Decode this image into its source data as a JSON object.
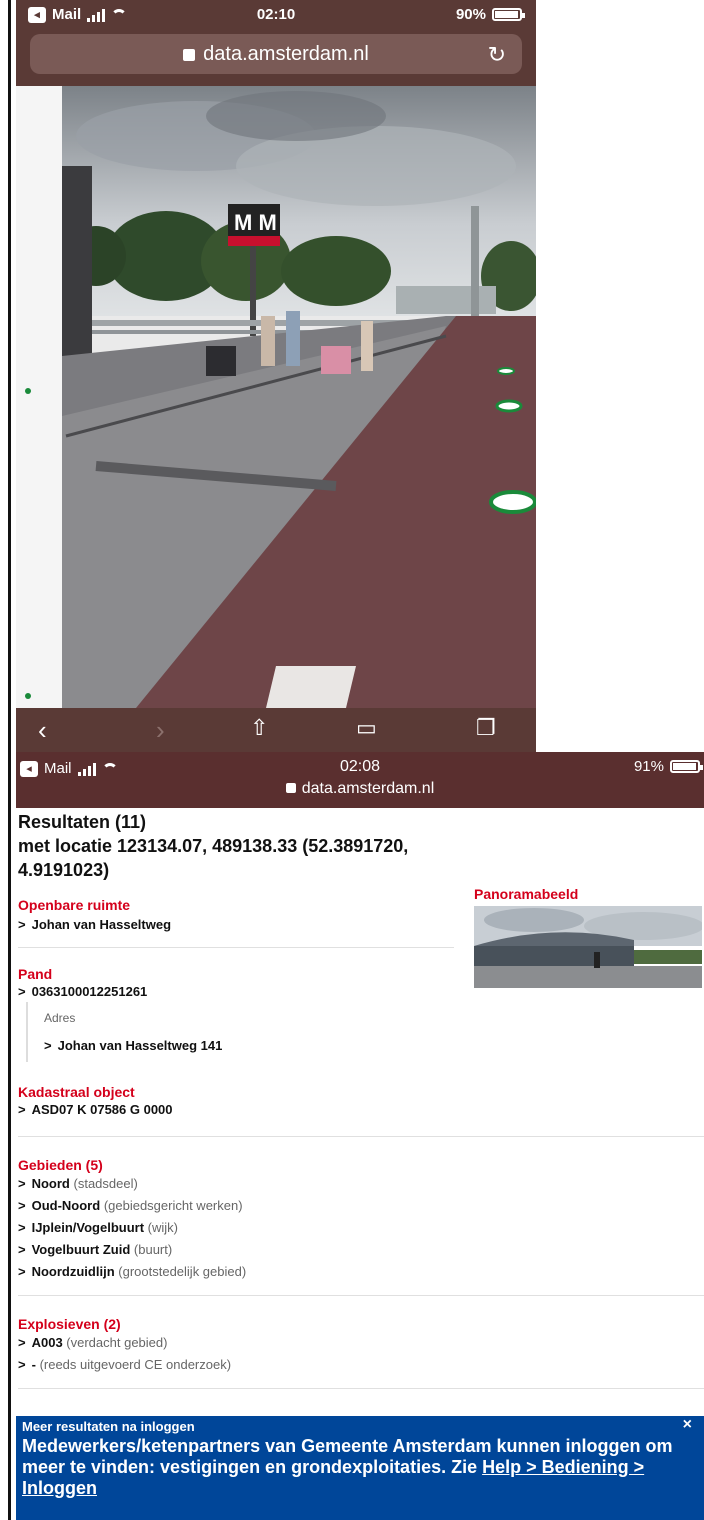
{
  "top": {
    "status": {
      "carrier": "Mail",
      "time": "02:10",
      "battery": "90%"
    },
    "url": "data.amsterdam.nl",
    "pano_sign": "M M"
  },
  "bottom": {
    "status": {
      "carrier": "Mail",
      "time": "02:08",
      "battery": "91%"
    },
    "url": "data.amsterdam.nl",
    "results_title": "Resultaten (11)",
    "location_line1": "met locatie 123134.07, 489138.33 (52.3891720,",
    "location_line2": "4.9191023)",
    "openbare": {
      "title": "Openbare ruimte",
      "item": "Johan van Hasseltweg"
    },
    "panorama_title": "Panoramabeeld",
    "pand": {
      "title": "Pand",
      "item": "0363100012251261",
      "adres_label": "Adres",
      "adres_item": "Johan van Hasseltweg 141"
    },
    "kadastraal": {
      "title": "Kadastraal object",
      "item": "ASD07 K 07586 G 0000"
    },
    "gebieden": {
      "title": "Gebieden (5)",
      "items": [
        {
          "name": "Noord",
          "type": "(stadsdeel)"
        },
        {
          "name": "Oud-Noord",
          "type": "(gebiedsgericht werken)"
        },
        {
          "name": "IJplein/Vogelbuurt",
          "type": "(wijk)"
        },
        {
          "name": "Vogelbuurt Zuid",
          "type": "(buurt)"
        },
        {
          "name": "Noordzuidlijn",
          "type": "(grootstedelijk gebied)"
        }
      ]
    },
    "explosieven": {
      "title": "Explosieven (2)",
      "items": [
        {
          "name": "A003",
          "type": "(verdacht gebied)"
        },
        {
          "name": "-",
          "type": "(reeds uitgevoerd CE onderzoek)"
        }
      ]
    },
    "banner": {
      "title": "Meer resultaten na inloggen",
      "close": "×",
      "body": "Medewerkers/ketenpartners van Gemeente Amsterdam kunnen inloggen om meer te vinden: vestigingen en grondexploitaties. Zie ",
      "link": "Help > Bediening > Inloggen"
    }
  }
}
